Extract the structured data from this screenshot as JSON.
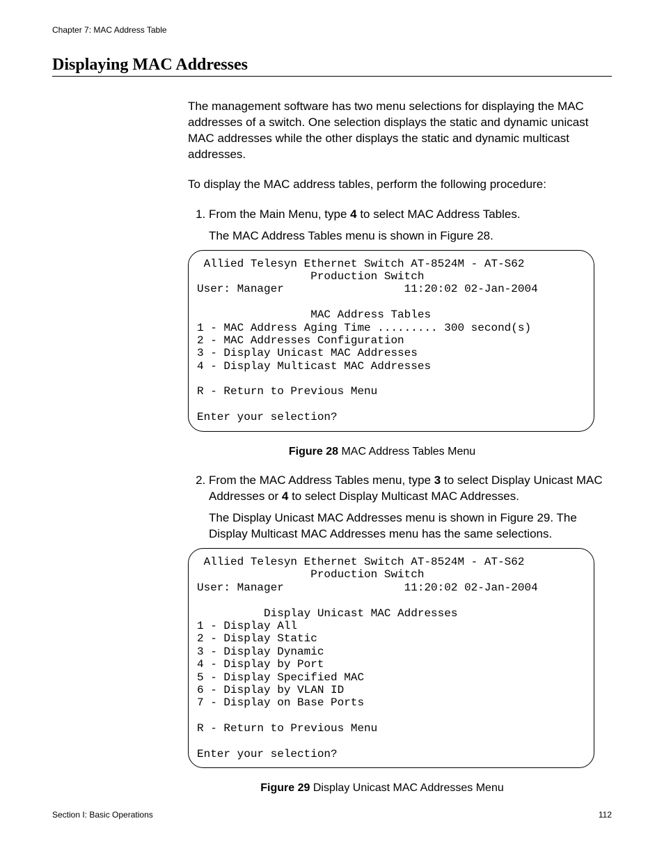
{
  "header": {
    "chapter": "Chapter 7: MAC Address Table"
  },
  "heading": "Displaying MAC Addresses",
  "intro_para1": "The management software has two menu selections for displaying the MAC addresses of a switch. One selection displays the static and dynamic unicast MAC addresses while the other displays the static and dynamic multicast addresses.",
  "intro_para2": "To display the MAC address tables, perform the following procedure:",
  "step1": {
    "pre": "From the Main Menu, type ",
    "bold": "4",
    "post": " to select MAC Address Tables.",
    "sub": "The MAC Address Tables menu is shown in Figure 28."
  },
  "terminal1": " Allied Telesyn Ethernet Switch AT-8524M - AT-S62\n                 Production Switch\nUser: Manager                  11:20:02 02-Jan-2004\n\n                 MAC Address Tables\n1 - MAC Address Aging Time ......... 300 second(s)\n2 - MAC Addresses Configuration\n3 - Display Unicast MAC Addresses\n4 - Display Multicast MAC Addresses\n\nR - Return to Previous Menu\n\nEnter your selection?",
  "fig28": {
    "label": "Figure 28",
    "text": "  MAC Address Tables Menu"
  },
  "step2": {
    "pre": "From the MAC Address Tables menu, type ",
    "bold1": "3",
    "mid": " to select Display Unicast MAC Addresses or ",
    "bold2": "4",
    "post": " to select Display Multicast MAC Addresses.",
    "sub": "The Display Unicast MAC Addresses menu is shown in Figure 29. The Display Multicast MAC Addresses menu has the same selections."
  },
  "terminal2": " Allied Telesyn Ethernet Switch AT-8524M - AT-S62\n                 Production Switch\nUser: Manager                  11:20:02 02-Jan-2004\n\n          Display Unicast MAC Addresses\n1 - Display All\n2 - Display Static\n3 - Display Dynamic\n4 - Display by Port\n5 - Display Specified MAC\n6 - Display by VLAN ID\n7 - Display on Base Ports\n\nR - Return to Previous Menu\n\nEnter your selection?",
  "fig29": {
    "label": "Figure 29",
    "text": "  Display Unicast MAC Addresses Menu"
  },
  "footer": {
    "left": "Section I: Basic Operations",
    "right": "112"
  }
}
